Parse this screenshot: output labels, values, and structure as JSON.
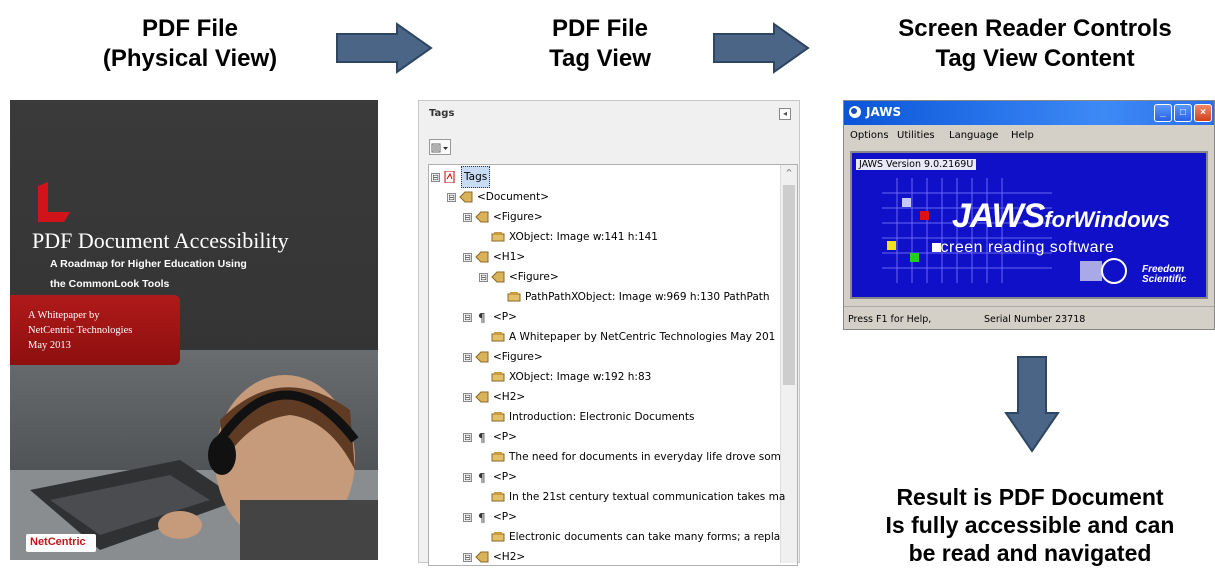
{
  "headings": {
    "pdf_physical_line1": "PDF File",
    "pdf_physical_line2": "(Physical View)",
    "pdf_tag_line1": "PDF File",
    "pdf_tag_line2": "Tag View",
    "reader_line1": "Screen Reader Controls",
    "reader_line2": "Tag View Content"
  },
  "cover": {
    "title": "PDF Document Accessibility",
    "subtitle_line1": "A Roadmap for Higher Education Using",
    "subtitle_line2": "the CommonLook Tools",
    "whitepaper_line1": "A Whitepaper by",
    "whitepaper_line2": "NetCentric Technologies",
    "whitepaper_line3": "May 2013",
    "logo_text": "NetCentric"
  },
  "tags_panel": {
    "title": "Tags",
    "close_glyph": "◂",
    "options_glyph": "▾",
    "scroll_up_glyph": "^",
    "rows": [
      {
        "toggle": "⊟",
        "label": "Tags",
        "selected": true
      },
      {
        "toggle": "⊟",
        "label": "<Document>"
      },
      {
        "toggle": "⊟",
        "label": "<Figure>"
      },
      {
        "toggle": "",
        "label": "XObject:  Image  w:141 h:141"
      },
      {
        "toggle": "⊟",
        "label": "<H1>"
      },
      {
        "toggle": "⊟",
        "label": "<Figure>"
      },
      {
        "toggle": "",
        "label": "PathPathXObject:  Image  w:969 h:130  PathPath"
      },
      {
        "toggle": "⊟",
        "label": "<P>"
      },
      {
        "toggle": "",
        "label": "A Whitepaper by NetCentric Technologies May 201"
      },
      {
        "toggle": "⊟",
        "label": "<Figure>"
      },
      {
        "toggle": "",
        "label": "XObject:  Image  w:192 h:83"
      },
      {
        "toggle": "⊟",
        "label": "<H2>"
      },
      {
        "toggle": "",
        "label": "Introduction: Electronic Documents"
      },
      {
        "toggle": "⊟",
        "label": "<P>"
      },
      {
        "toggle": "",
        "label": "The need for documents in everyday life drove som"
      },
      {
        "toggle": "⊟",
        "label": "<P>"
      },
      {
        "toggle": "",
        "label": "In the 21st century textual communication takes ma"
      },
      {
        "toggle": "⊟",
        "label": "<P>"
      },
      {
        "toggle": "",
        "label": "Electronic documents can take many forms; a repla"
      },
      {
        "toggle": "⊟",
        "label": "<H2>"
      }
    ]
  },
  "jaws": {
    "title": "JAWS",
    "menu": [
      "Options",
      "Utilities",
      "Language",
      "Help"
    ],
    "version": "JAWS Version 9.0.2169U",
    "brand_main": "JAWS",
    "brand_suffix": "forWindows",
    "tagline": "screen reading software",
    "maker_line1": "Freedom",
    "maker_line2": "Scientific",
    "status_help": "Press F1 for Help,",
    "status_serial": "Serial Number 23718"
  },
  "result": {
    "line1": "Result is PDF Document",
    "line2": "Is fully accessible and can",
    "line3": "be read and navigated"
  },
  "colors": {
    "arrow_fill": "#4a6585",
    "jaws_blue": "#1010c8",
    "cover_red": "#a51414"
  }
}
